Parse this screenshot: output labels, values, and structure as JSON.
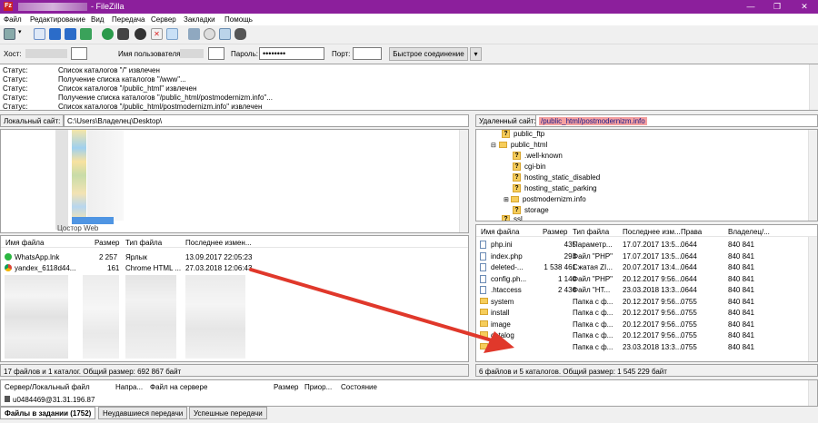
{
  "window": {
    "title": "- FileZilla",
    "controls": [
      "—",
      "❐",
      "✕"
    ]
  },
  "menu": [
    "Файл",
    "Редактирование",
    "Вид",
    "Передача",
    "Сервер",
    "Закладки",
    "Помощь"
  ],
  "quickconnect": {
    "host_label": "Хост:",
    "user_label": "Имя пользователя",
    "pass_label": "Пароль:",
    "pass_value": "••••••••",
    "port_label": "Порт:",
    "connect_button": "Быстрое соединение",
    "dropdown": "▾"
  },
  "log": [
    {
      "k": "Статус:",
      "v": "Список каталогов \"/\" извлечен"
    },
    {
      "k": "Статус:",
      "v": "Получение списка каталогов \"/www\"..."
    },
    {
      "k": "Статус:",
      "v": "Список каталогов \"/public_html\" извлечен"
    },
    {
      "k": "Статус:",
      "v": "Получение списка каталогов \"/public_html/postmodernizm.info\"..."
    },
    {
      "k": "Статус:",
      "v": "Список каталогов \"/public_html/postmodernizm.info\" извлечен"
    }
  ],
  "local": {
    "site_label": "Локальный сайт:",
    "path": "C:\\Users\\Владелец\\Desktop\\",
    "tree_partial": "Цостор Web",
    "columns": [
      "Имя файла",
      "Размер",
      "Тип файла",
      "Последнее измен..."
    ],
    "files": [
      {
        "name": "WhatsApp.lnk",
        "size": "2 257",
        "type": "Ярлык",
        "modified": "13.09.2017 22:05:23",
        "icon": "whatsapp-icon"
      },
      {
        "name": "yandex_6118d44...",
        "size": "161",
        "type": "Chrome HTML ...",
        "modified": "27.03.2018 12:06:43",
        "icon": "chrome-icon"
      }
    ],
    "status": "17 файлов и 1 каталог. Общий размер: 692 867 байт"
  },
  "remote": {
    "site_label": "Удаленный сайт:",
    "path": "/public_html/postmodernizm.info",
    "tree": [
      {
        "label": "public_ftp",
        "indent": 0,
        "kind": "q"
      },
      {
        "label": "public_html",
        "indent": 0,
        "kind": "open"
      },
      {
        "label": ".well-known",
        "indent": 1,
        "kind": "q"
      },
      {
        "label": "cgi-bin",
        "indent": 1,
        "kind": "q"
      },
      {
        "label": "hosting_static_disabled",
        "indent": 1,
        "kind": "q"
      },
      {
        "label": "hosting_static_parking",
        "indent": 1,
        "kind": "q"
      },
      {
        "label": "postmodernizm.info",
        "indent": 1,
        "kind": "plus"
      },
      {
        "label": "storage",
        "indent": 1,
        "kind": "q"
      },
      {
        "label": "ssl",
        "indent": 0,
        "kind": "q"
      }
    ],
    "columns": [
      "Имя файла",
      "Размер",
      "Тип файла",
      "Последнее изм...",
      "Права",
      "Владелец/..."
    ],
    "files": [
      {
        "name": "php.ini",
        "size": "435",
        "type": "Параметр...",
        "modified": "17.07.2017 13:5...",
        "perms": "0644",
        "owner": "840 841",
        "kind": "file"
      },
      {
        "name": "index.php",
        "size": "293",
        "type": "Файл \"PHP\"",
        "modified": "17.07.2017 13:5...",
        "perms": "0644",
        "owner": "840 841",
        "kind": "file"
      },
      {
        "name": "deleted-...",
        "size": "1 538 461",
        "type": "Сжатая ZI...",
        "modified": "20.07.2017 13:4...",
        "perms": "0644",
        "owner": "840 841",
        "kind": "file"
      },
      {
        "name": "config.ph...",
        "size": "1 140",
        "type": "Файл \"PHP\"",
        "modified": "20.12.2017 9:56...",
        "perms": "0644",
        "owner": "840 841",
        "kind": "file"
      },
      {
        "name": ".htaccess",
        "size": "2 436",
        "type": "Файл \"HT...",
        "modified": "23.03.2018 13:3...",
        "perms": "0644",
        "owner": "840 841",
        "kind": "file"
      },
      {
        "name": "system",
        "size": "",
        "type": "Папка с ф...",
        "modified": "20.12.2017 9:56...",
        "perms": "0755",
        "owner": "840 841",
        "kind": "folder"
      },
      {
        "name": "install",
        "size": "",
        "type": "Папка с ф...",
        "modified": "20.12.2017 9:56...",
        "perms": "0755",
        "owner": "840 841",
        "kind": "folder"
      },
      {
        "name": "image",
        "size": "",
        "type": "Папка с ф...",
        "modified": "20.12.2017 9:56...",
        "perms": "0755",
        "owner": "840 841",
        "kind": "folder"
      },
      {
        "name": "catalog",
        "size": "",
        "type": "Папка с ф...",
        "modified": "20.12.2017 9:56...",
        "perms": "0755",
        "owner": "840 841",
        "kind": "folder"
      },
      {
        "name": "",
        "size": "",
        "type": "Папка с ф...",
        "modified": "23.03.2018 13:3...",
        "perms": "0755",
        "owner": "840 841",
        "kind": "folder"
      }
    ],
    "status": "6 файлов и 5 каталогов. Общий размер: 1 545 229 байт"
  },
  "queue": {
    "columns": [
      "Сервер/Локальный файл",
      "Напра...",
      "Файл на сервере",
      "Размер",
      "Приор...",
      "Состояние"
    ],
    "row": "u0484469@31.31.196.87"
  },
  "tabs": [
    "Файлы в задании (1752)",
    "Неудавшиеся передачи",
    "Успешные передачи"
  ],
  "colors": {
    "titlebar": "#8c1f9c",
    "arrow": "#e0382b",
    "folder": "#f6cd5b"
  }
}
